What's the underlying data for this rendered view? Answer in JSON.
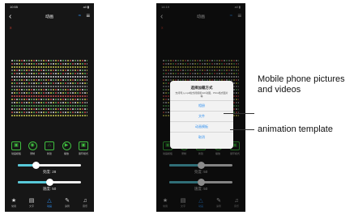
{
  "phone1": {
    "time": "10:55",
    "signal": "all ▮",
    "title": "动画",
    "close": "x",
    "controls": [
      {
        "icon": "▣",
        "label": "动画模板"
      },
      {
        "icon": "◉",
        "label": "录制"
      },
      {
        "icon": "⌂",
        "label": "新建"
      },
      {
        "icon": "▶",
        "label": "播放"
      },
      {
        "icon": "▣",
        "label": "循环模式"
      }
    ],
    "brightness_label": "亮度: 28",
    "brightness": 28,
    "speed_label": "速度: 50",
    "speed": 50,
    "tabs": [
      "常用",
      "文字",
      "动画",
      "涂鸦",
      "音乐"
    ]
  },
  "phone2": {
    "time": "14:19",
    "signal": "all ▮",
    "title": "动画",
    "close": "x",
    "controls": [
      {
        "icon": "▣",
        "label": "动画模板"
      },
      {
        "icon": "◉",
        "label": "录制"
      },
      {
        "icon": "⌂",
        "label": "新建"
      },
      {
        "icon": "▶",
        "label": "播放"
      },
      {
        "icon": "▣",
        "label": "循环模式"
      }
    ],
    "brightness_label": "亮度: 50",
    "brightness": 50,
    "speed_label": "速度: 50",
    "speed": 50,
    "tabs": [
      "常用",
      "文字",
      "动画",
      "涂鸦",
      "音乐"
    ],
    "dialog": {
      "title": "选择加载方式",
      "message": "支持导入mp4格式视频和GIF动图，PNG格式图片等",
      "options": [
        "相册",
        "文件",
        "动画模板",
        "取消"
      ]
    }
  },
  "annotations": {
    "photos_note": "Mobile phone pictures and videos",
    "template_note": "animation template"
  }
}
